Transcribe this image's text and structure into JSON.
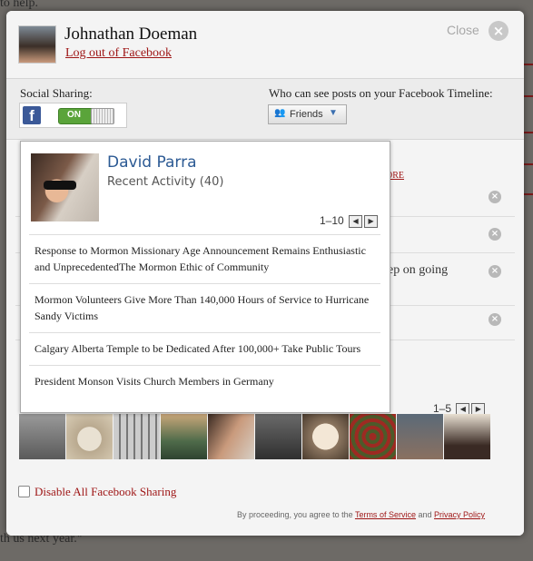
{
  "background": {
    "top_text": "to help.",
    "bottom_text": "th us next year.\""
  },
  "header": {
    "user_name": "Johnathan Doeman",
    "logout_label": "Log out of Facebook",
    "close_label": "Close"
  },
  "sharing": {
    "label": "Social Sharing:",
    "toggle_state": "ON",
    "visibility_label": "Who can see posts on your Facebook Timeline:",
    "visibility_value": "Friends"
  },
  "content": {
    "more_label": "ORE",
    "partial_row_text": "ep on going"
  },
  "popover": {
    "name": "David Parra",
    "subtitle": "Recent Activity (40)",
    "pager": "1–10",
    "activities": [
      "Response to Mormon Missionary Age Announcement Remains Enthusiastic and UnprecedentedThe Mormon Ethic of Community",
      "Mormon Volunteers Give More Than 140,000 Hours of Service to Hurricane Sandy Victims",
      "Calgary Alberta Temple to be Dedicated After 100,000+ Take Public Tours",
      "President Monson Visits Church Members in Germany"
    ]
  },
  "friends": {
    "pager": "1–5"
  },
  "footer": {
    "disable_label": "Disable All Facebook Sharing",
    "terms_prefix": "By proceeding, you agree to the",
    "terms_link": "Terms of Service",
    "terms_and": "and",
    "privacy_link": "Privacy Policy"
  },
  "colors": {
    "accent_red": "#9e1515",
    "facebook_blue": "#3b5998",
    "toggle_green": "#5aa43a",
    "name_blue": "#2c5a94"
  }
}
